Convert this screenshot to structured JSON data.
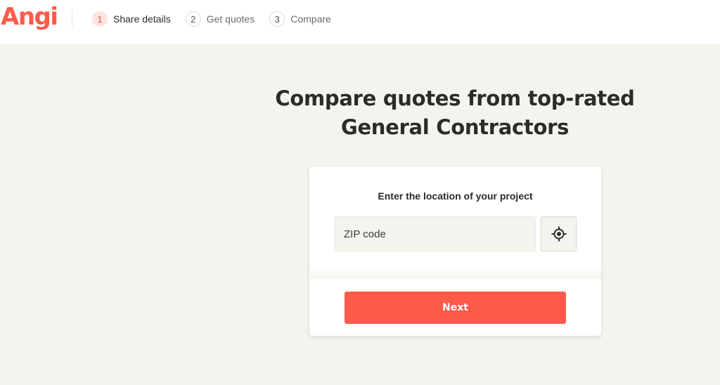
{
  "header": {
    "logo_text": "Angi",
    "steps": [
      {
        "number": "1",
        "label": "Share details",
        "active": true
      },
      {
        "number": "2",
        "label": "Get quotes",
        "active": false
      },
      {
        "number": "3",
        "label": "Compare",
        "active": false
      }
    ]
  },
  "main": {
    "headline_line1": "Compare quotes from top-rated",
    "headline_line2": "General Contractors",
    "card": {
      "label": "Enter the location of your project",
      "zip_placeholder": "ZIP code",
      "zip_value": "",
      "locate_icon": "crosshair-locate-icon",
      "next_label": "Next"
    }
  },
  "colors": {
    "brand": "#ff5a4a",
    "background": "#f4f4ef",
    "active_step_bg": "#ffe3df"
  }
}
